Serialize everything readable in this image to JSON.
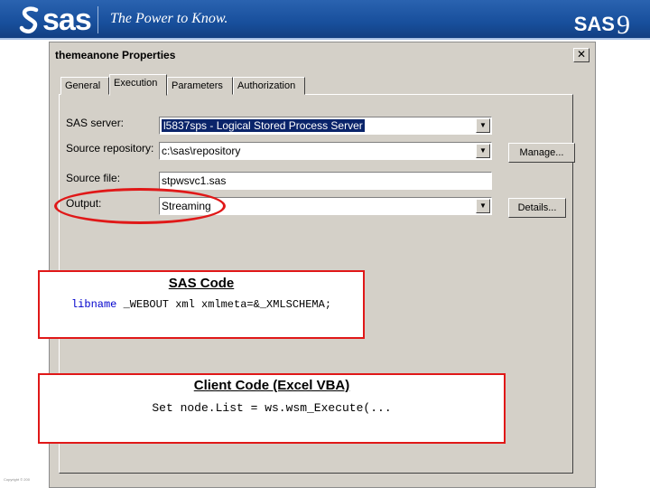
{
  "banner": {
    "logo_text": "sas",
    "tagline": "The Power to Know.",
    "version_text": "SAS",
    "version_number": "9"
  },
  "copyright": "Copyright © 200",
  "dialog": {
    "title": "themeanone Properties",
    "close_glyph": "✕",
    "tabs": [
      {
        "label": "General",
        "active": false
      },
      {
        "label": "Execution",
        "active": true
      },
      {
        "label": "Parameters",
        "active": false
      },
      {
        "label": "Authorization",
        "active": false
      }
    ],
    "fields": {
      "sas_server": {
        "label": "SAS server:",
        "value": "l5837sps - Logical Stored Process Server"
      },
      "source_repository": {
        "label": "Source repository:",
        "value": "c:\\sas\\repository"
      },
      "source_file": {
        "label": "Source file:",
        "value": "stpwsvc1.sas"
      },
      "output": {
        "label": "Output:",
        "value": "Streaming"
      }
    },
    "buttons": {
      "manage": "Manage...",
      "details": "Details..."
    },
    "highlight_color": "#e01818"
  },
  "sas_code": {
    "heading": "SAS Code",
    "keyword": "libname",
    "code_rest": " _WEBOUT xml xmlmeta=&_XMLSCHEMA;"
  },
  "client_code": {
    "heading": "Client Code (Excel VBA)",
    "code": "Set node.List = ws.wsm_Execute(..."
  }
}
